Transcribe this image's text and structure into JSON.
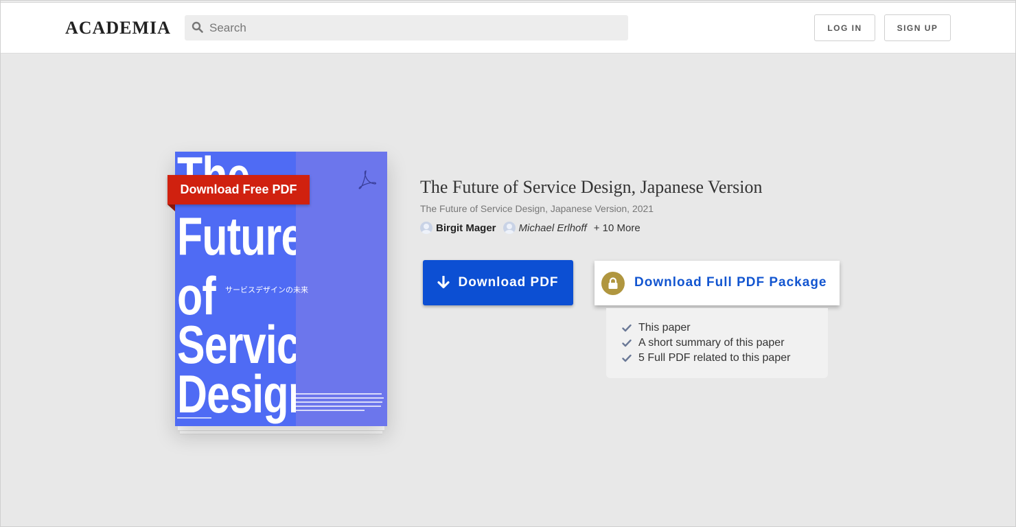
{
  "header": {
    "logo": "ACADEMIA",
    "search_placeholder": "Search",
    "login_label": "LOG IN",
    "signup_label": "SIGN UP"
  },
  "cover": {
    "ribbon_label": "Download Free PDF",
    "lines": [
      "The",
      "Future",
      "of",
      "Service",
      "Design"
    ],
    "japanese_subtitle": "サービスデザインの未来"
  },
  "paper": {
    "title": "The Future of Service Design, Japanese Version",
    "subtitle": "The Future of Service Design, Japanese Version, 2021",
    "authors": [
      "Birgit Mager",
      "Michael Erlhoff"
    ],
    "more_authors": "+ 10 More"
  },
  "actions": {
    "download_pdf_label": "Download PDF",
    "download_package_label": "Download Full PDF Package",
    "package_items": [
      "This paper",
      "A short summary of this paper",
      "5 Full PDF related to this paper"
    ]
  },
  "colors": {
    "primary_blue": "#0c4fd3",
    "ribbon_red": "#d0210f",
    "lock_gold": "#b0963f",
    "cover_blue": "#4f6bf4"
  }
}
